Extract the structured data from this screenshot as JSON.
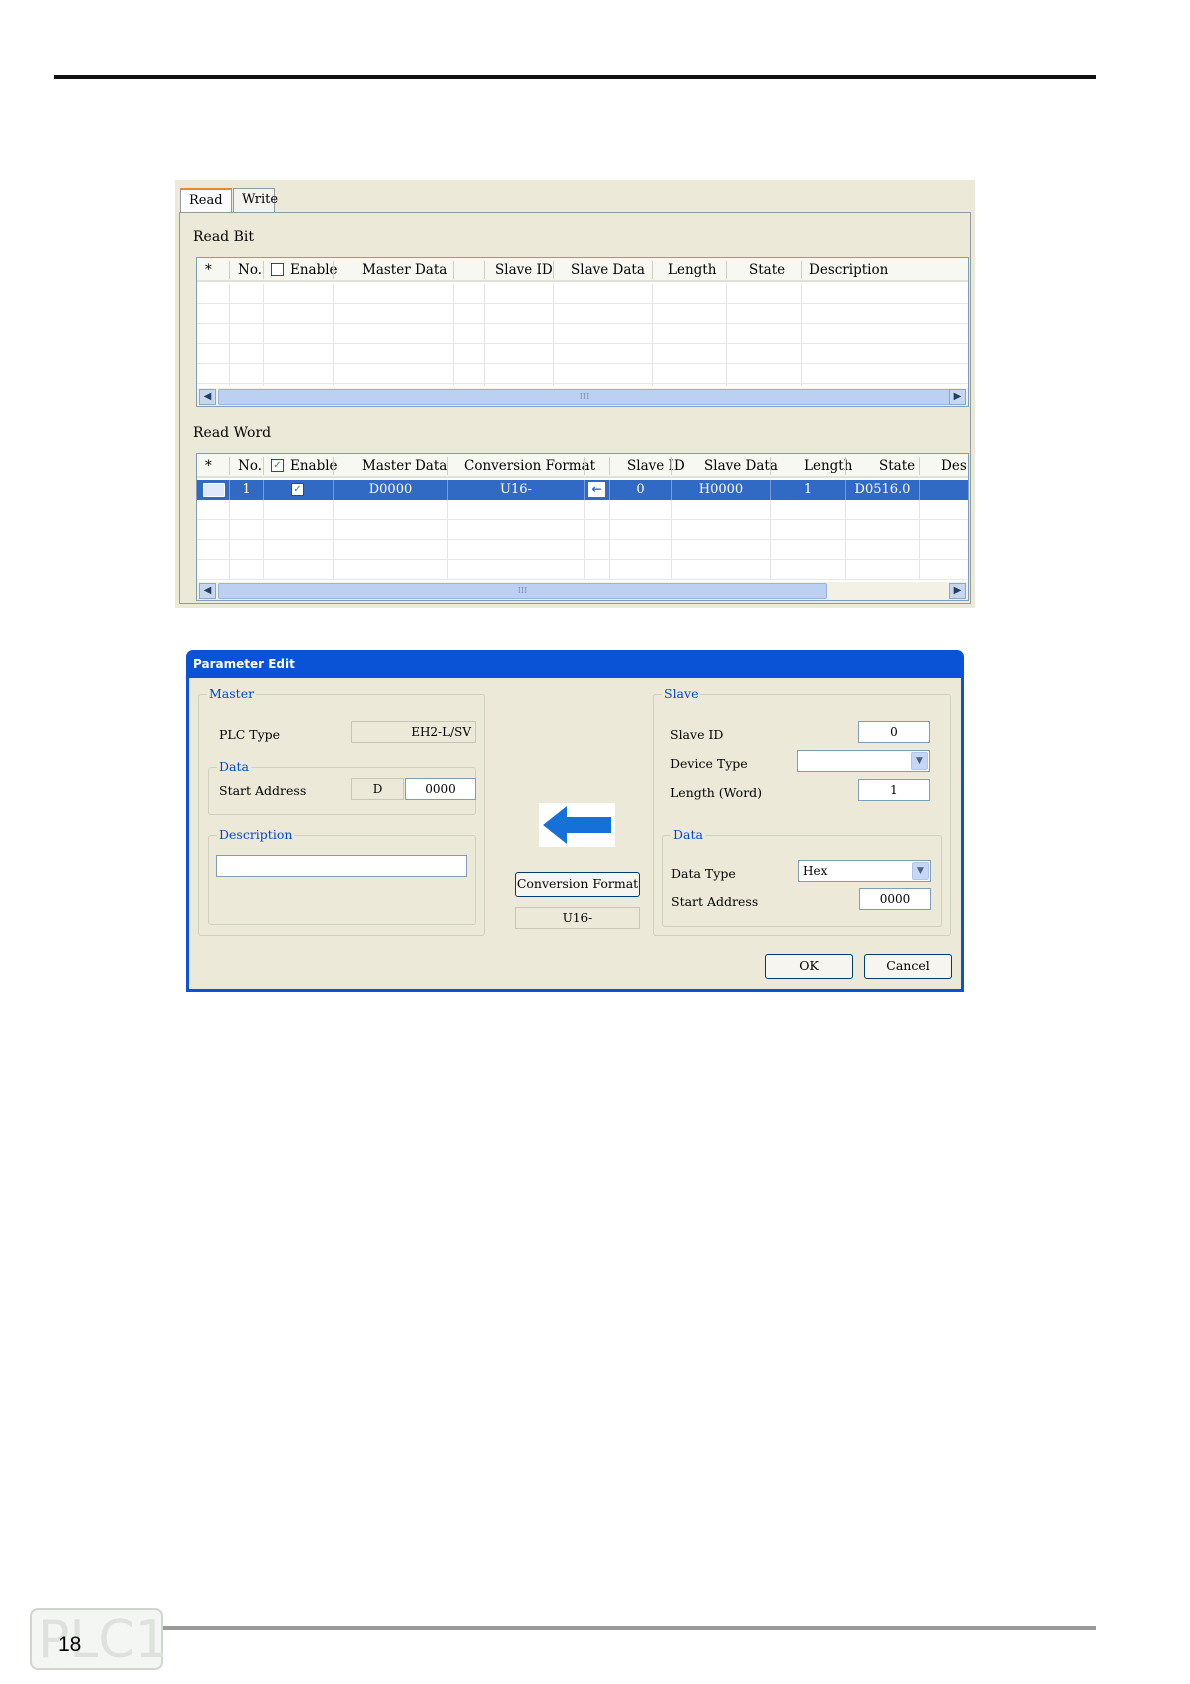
{
  "panel1": {
    "tabs": [
      "Read",
      "Write"
    ],
    "read_bit": {
      "label": "Read Bit",
      "columns": [
        "*",
        "No.",
        "Enable",
        "Master Data",
        "Slave ID",
        "Slave Data",
        "Length",
        "State",
        "Description"
      ]
    },
    "read_word": {
      "label": "Read Word",
      "columns": [
        "*",
        "No.",
        "Enable",
        "Master Data",
        "Conversion Format",
        "Slave ID",
        "Slave Data",
        "Length",
        "State",
        "Des"
      ],
      "rows": [
        {
          "no": "1",
          "master_data": "D0000",
          "conversion_format": "U16-",
          "slave_id": "0",
          "slave_data": "H0000",
          "length": "1",
          "state": "D0516.0"
        }
      ]
    },
    "scroll_grip": "III"
  },
  "dialog": {
    "title": "Parameter Edit",
    "master": {
      "caption": "Master",
      "plc_type_label": "PLC Type",
      "plc_type_value": "EH2-L/SV",
      "data_caption": "Data",
      "start_address_label": "Start Address",
      "start_address_device": "D",
      "start_address_value": "0000",
      "description_caption": "Description",
      "description_value": ""
    },
    "conversion_button": "Conversion Format",
    "conversion_value": "U16-",
    "slave": {
      "caption": "Slave",
      "slave_id_label": "Slave ID",
      "slave_id_value": "0",
      "device_type_label": "Device Type",
      "device_type_value": "",
      "length_label": "Length (Word)",
      "length_value": "1",
      "data_caption": "Data",
      "data_type_label": "Data Type",
      "data_type_value": "Hex",
      "start_address_label": "Start Address",
      "start_address_value": "0000"
    },
    "ok": "OK",
    "cancel": "Cancel",
    "arrow_color": "#1570d8"
  },
  "footer": {
    "page_number": "18",
    "logo_text": "PLC1"
  }
}
